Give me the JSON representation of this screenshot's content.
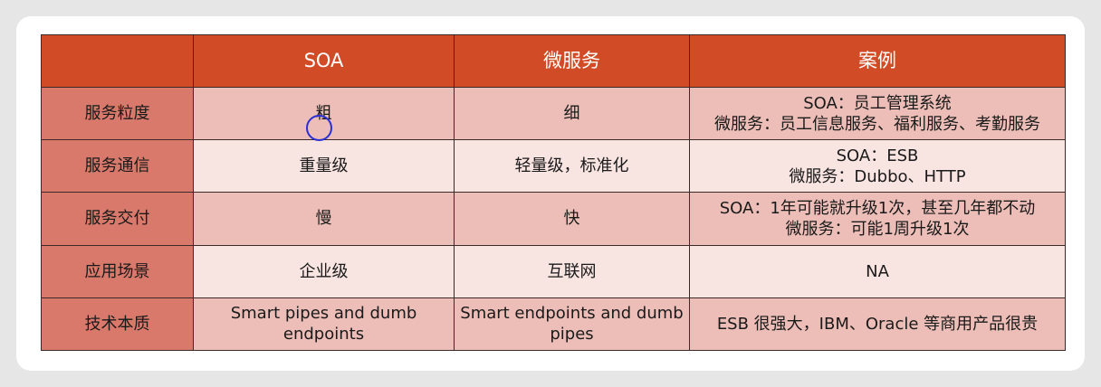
{
  "table": {
    "headers": [
      "",
      "SOA",
      "微服务",
      "案例"
    ],
    "rows": [
      {
        "label": "服务粒度",
        "soa": "粗",
        "micro": "细",
        "case": [
          "SOA：员工管理系统",
          "微服务：员工信息服务、福利服务、考勤服务"
        ]
      },
      {
        "label": "服务通信",
        "soa": "重量级",
        "micro": "轻量级，标准化",
        "case": [
          "SOA：ESB",
          "微服务：Dubbo、HTTP"
        ]
      },
      {
        "label": "服务交付",
        "soa": "慢",
        "micro": "快",
        "case": [
          "SOA：1年可能就升级1次，甚至几年都不动",
          "微服务：可能1周升级1次"
        ]
      },
      {
        "label": "应用场景",
        "soa": "企业级",
        "micro": "互联网",
        "case": [
          "NA"
        ]
      },
      {
        "label": "技术本质",
        "soa": "Smart pipes and dumb endpoints",
        "micro": "Smart endpoints and dumb pipes",
        "case": [
          "ESB 很强大，IBM、Oracle 等商用产品很贵"
        ]
      }
    ]
  },
  "colors": {
    "header_bg": "#d14b26",
    "label_col_bg": "#d8796b",
    "row_dark": "#ecbeb7",
    "row_light": "#f8e4e1",
    "cursor": "#2b2fd6"
  }
}
